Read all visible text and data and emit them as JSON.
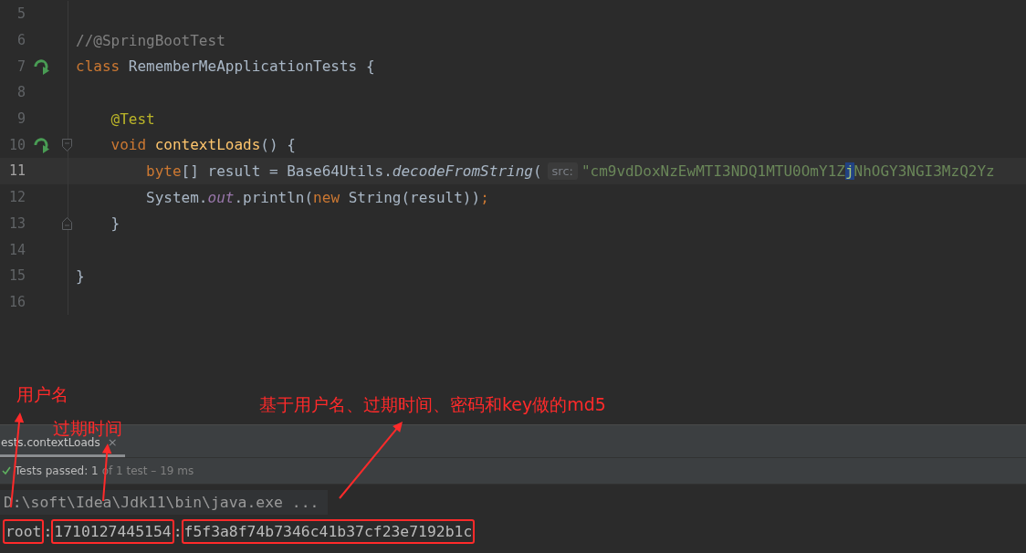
{
  "editor": {
    "lines": [
      {
        "number": "5",
        "current": false
      },
      {
        "number": "6",
        "current": false,
        "tokens": [
          {
            "text": "//@SpringBootTest",
            "kind": "comment"
          }
        ]
      },
      {
        "number": "7",
        "current": false,
        "markers": [
          {
            "kind": "run"
          }
        ],
        "tokens": [
          {
            "text": "class ",
            "kind": "keyword"
          },
          {
            "text": "RememberMeApplicationTests {",
            "kind": "plain"
          }
        ]
      },
      {
        "number": "8",
        "current": false
      },
      {
        "number": "9",
        "current": false,
        "tokens": [
          {
            "text": "    @Test",
            "kind": "annotation"
          }
        ]
      },
      {
        "number": "10",
        "current": false,
        "markers": [
          {
            "kind": "run"
          },
          {
            "kind": "fold-start"
          }
        ],
        "tokens": [
          {
            "text": "    void ",
            "kind": "keyword"
          },
          {
            "text": "contextLoads",
            "kind": "method"
          },
          {
            "text": "() {",
            "kind": "plain"
          }
        ]
      },
      {
        "number": "11",
        "current": true,
        "tokens": [
          {
            "text": "        byte",
            "kind": "keyword"
          },
          {
            "text": "[] result = Base64Utils.",
            "kind": "plain"
          },
          {
            "text": "decodeFromString",
            "kind": "italic"
          },
          {
            "text": "(",
            "kind": "plain"
          },
          {
            "text": "src:",
            "kind": "hint"
          },
          {
            "text": "\"cm9vdDoxNzEwMTI3NDQ1MTU0OmY1Z",
            "kind": "string"
          },
          {
            "text": "j",
            "kind": "caret-char"
          },
          {
            "text": "NhOGY3NGI3MzQ2Yz",
            "kind": "string"
          }
        ]
      },
      {
        "number": "12",
        "current": false,
        "tokens": [
          {
            "text": "        System.",
            "kind": "plain"
          },
          {
            "text": "out",
            "kind": "static"
          },
          {
            "text": ".println(",
            "kind": "plain"
          },
          {
            "text": "new ",
            "kind": "keyword"
          },
          {
            "text": "String(result))",
            "kind": "plain"
          },
          {
            "text": ";",
            "kind": "keyword"
          }
        ]
      },
      {
        "number": "13",
        "current": false,
        "markers": [
          {
            "kind": "fold-end"
          }
        ],
        "tokens": [
          {
            "text": "    }",
            "kind": "plain"
          }
        ]
      },
      {
        "number": "14",
        "current": false
      },
      {
        "number": "15",
        "current": false,
        "tokens": [
          {
            "text": "}",
            "kind": "plain"
          }
        ]
      },
      {
        "number": "16",
        "current": false
      }
    ]
  },
  "run_panel": {
    "tab": "ests.contextLoads",
    "tab_close": "×",
    "status": "Tests passed: 1",
    "status_detail": "of 1 test – 19 ms",
    "console": [
      {
        "kind": "command",
        "tokens": [
          {
            "text": "D:\\soft\\Idea\\Jdk11\\bin\\java.exe ..."
          }
        ]
      },
      {
        "kind": "output",
        "tokens": [
          {
            "text": "root",
            "boxed": true
          },
          {
            "text": ":",
            "boxed": false
          },
          {
            "text": "1710127445154",
            "boxed": true
          },
          {
            "text": ":",
            "boxed": false
          },
          {
            "text": "f5f3a8f74b7346c41b37cf23e7192b1c",
            "boxed": true
          }
        ]
      }
    ]
  },
  "annotations": [
    {
      "text": "用户名"
    },
    {
      "text": "过期时间"
    },
    {
      "text": "基于用户名、过期时间、密码和key做的md5"
    }
  ]
}
